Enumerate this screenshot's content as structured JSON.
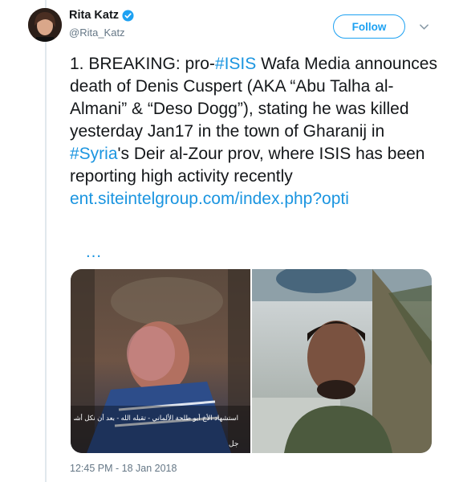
{
  "user": {
    "name": "Rita Katz",
    "handle": "@Rita_Katz",
    "verified": true
  },
  "follow_label": "Follow",
  "tweet": {
    "segments": [
      {
        "type": "text",
        "value": "1. BREAKING: pro-"
      },
      {
        "type": "hashtag",
        "value": "#ISIS"
      },
      {
        "type": "text",
        "value": " Wafa Media announces death of Denis Cuspert (AKA “Abu Talha al-Almani” & “Deso Dogg”), stating he was killed yesterday Jan17  in the town of Gharanij in "
      },
      {
        "type": "hashtag",
        "value": "#Syria"
      },
      {
        "type": "text",
        "value": "'s Deir al-Zour prov, where ISIS has been reporting high activity recently "
      },
      {
        "type": "link",
        "value": "ent.siteintelgroup.com/index.php?opti"
      }
    ],
    "ellipsis": "…"
  },
  "media": {
    "left_caption": "استشهاد الأخ أبو طلحة الألماني - تقبله الله - بعد أن نكل أشد النكاية",
    "left_overlay": "جل"
  },
  "timestamp": "12:45 PM - 18 Jan 2018",
  "colors": {
    "link": "#1b95e0",
    "follow": "#1da1f2",
    "secondary_text": "#657786"
  },
  "icons": [
    "verified-icon",
    "chevron-down-icon"
  ]
}
